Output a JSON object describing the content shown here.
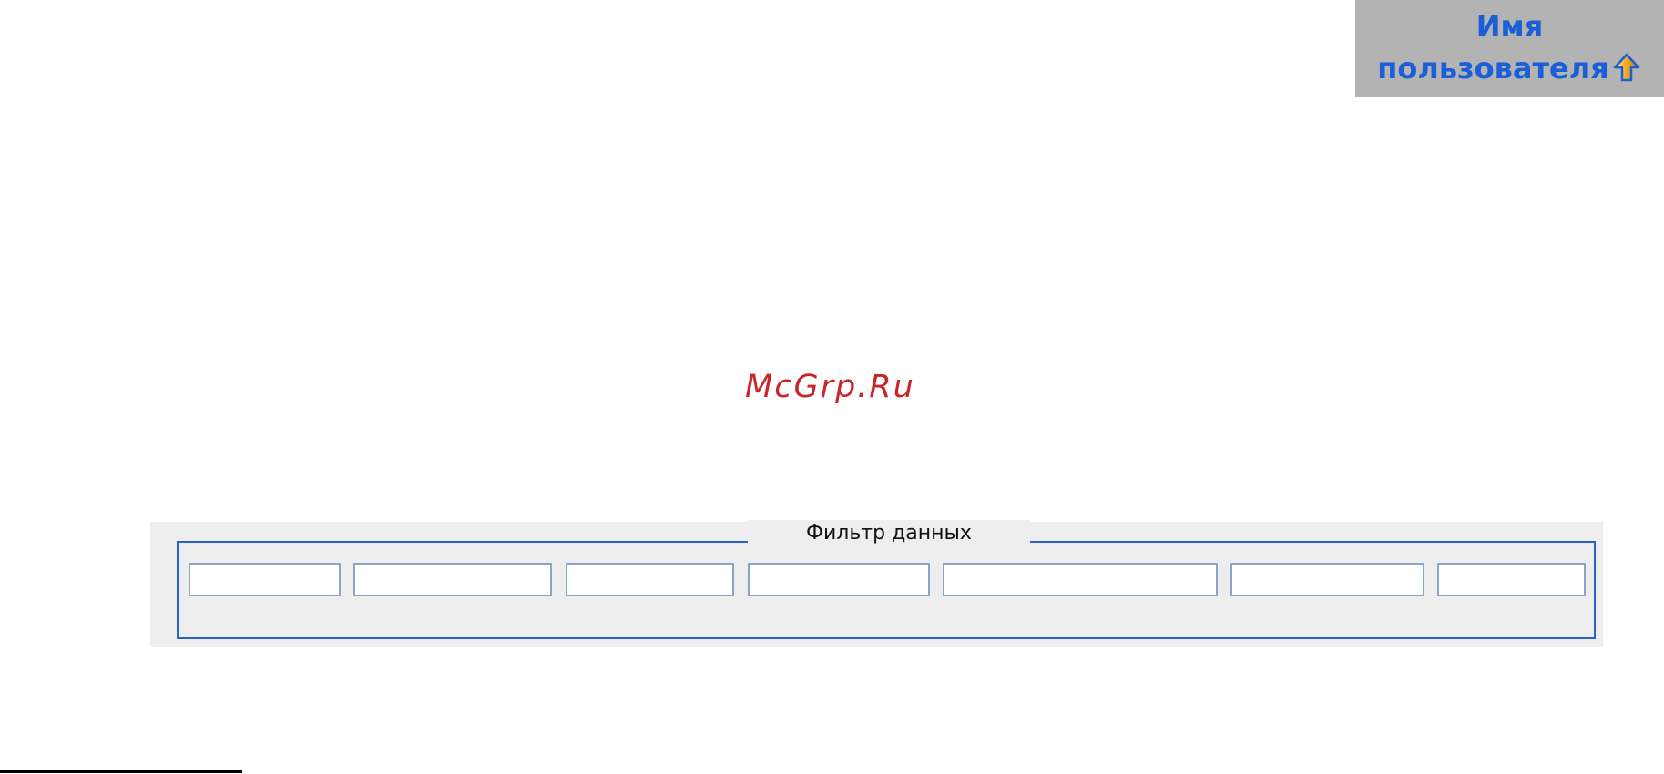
{
  "column_header": {
    "line1": "Имя",
    "line2": "пользователя",
    "sort_icon": "arrow-up-icon",
    "background_color": "#b3b3b3",
    "text_color": "#1a5fd8"
  },
  "watermark": {
    "text": "McGrp.Ru",
    "color": "#c8262b"
  },
  "filter": {
    "legend": "Фильтр данных",
    "border_color": "#2a62cc",
    "inputs": [
      {
        "value": "",
        "placeholder": ""
      },
      {
        "value": "",
        "placeholder": ""
      },
      {
        "value": "",
        "placeholder": ""
      },
      {
        "value": "",
        "placeholder": ""
      },
      {
        "value": "",
        "placeholder": ""
      },
      {
        "value": "",
        "placeholder": ""
      },
      {
        "value": "",
        "placeholder": ""
      }
    ]
  }
}
